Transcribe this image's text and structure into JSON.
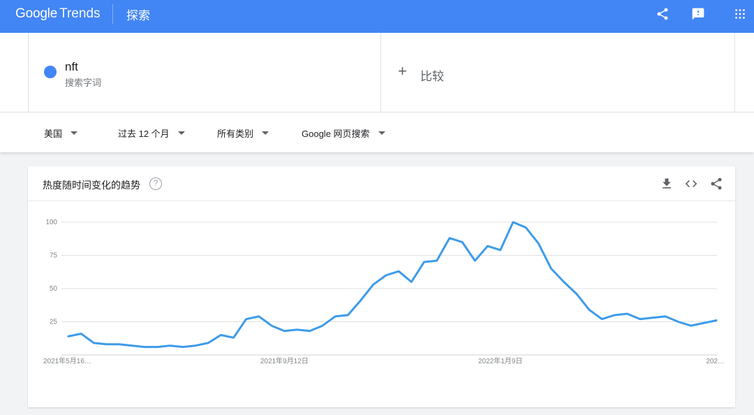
{
  "header": {
    "logo_google": "Google",
    "logo_trends": "Trends",
    "nav_title": "探索",
    "icons": [
      "share-icon",
      "feedback-icon",
      "apps-icon"
    ]
  },
  "search_term": {
    "name": "nft",
    "subtitle": "搜索字词",
    "color": "#4285f4"
  },
  "compare": {
    "plus": "+",
    "label": "比较"
  },
  "filters": [
    {
      "label": "美国"
    },
    {
      "label": "过去 12 个月"
    },
    {
      "label": "所有类别"
    },
    {
      "label": "Google 网页搜索"
    }
  ],
  "card": {
    "title": "热度随时间变化的趋势",
    "help": "?",
    "icons": [
      "download-icon",
      "embed-icon",
      "share-icon"
    ]
  },
  "chart_data": {
    "type": "line",
    "title": "热度随时间变化的趋势",
    "xlabel": "",
    "ylabel": "",
    "ylim": [
      0,
      100
    ],
    "yticks": [
      25,
      50,
      75,
      100
    ],
    "x_tick_labels": [
      {
        "label": "2021年5月16…",
        "index": 0
      },
      {
        "label": "2021年9月12日",
        "index": 17
      },
      {
        "label": "2022年1月9日",
        "index": 34
      },
      {
        "label": "202…",
        "index": 51
      }
    ],
    "grid": true,
    "legend": "none",
    "series": [
      {
        "color": "#4285f4",
        "values": [
          14,
          16,
          9,
          8,
          8,
          7,
          6,
          6,
          7,
          6,
          7,
          9,
          15,
          13,
          27,
          29,
          22,
          18,
          19,
          18,
          22,
          29,
          30,
          41,
          53,
          60,
          63,
          55,
          70,
          71,
          88,
          85,
          71,
          82,
          79,
          100,
          96,
          84,
          65,
          55,
          46,
          34,
          27,
          30,
          31,
          27,
          28,
          29,
          25,
          22,
          24,
          26
        ]
      }
    ]
  }
}
